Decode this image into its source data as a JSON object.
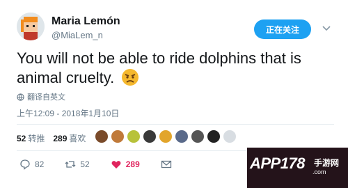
{
  "user": {
    "name": "Maria Lemón",
    "handle": "@MiaLem_n"
  },
  "follow_button": {
    "label": "正在关注"
  },
  "tweet": {
    "text": "You will not be able to ride dolphins that is animal cruelty.",
    "emoji": "angry-face"
  },
  "translate": {
    "label": "翻译自英文"
  },
  "timestamp": "上午12:09 - 2018年1月10日",
  "stats": {
    "retweets_count": "52",
    "retweets_label": "转推",
    "likes_count": "289",
    "likes_label": "喜欢"
  },
  "likers_colors": [
    "#7a4b2a",
    "#c07a3a",
    "#b8c23a",
    "#3a3a3a",
    "#e2a52b",
    "#5a6a8a",
    "#555555",
    "#222222",
    "#d8dde2"
  ],
  "actions": {
    "replies": "82",
    "retweets": "52",
    "likes": "289"
  },
  "watermark": {
    "brand": "APP178",
    "sub": "手游网",
    "domain": ".com"
  },
  "colors": {
    "accent": "#1da1f2",
    "like": "#e0245e",
    "muted": "#657786"
  }
}
